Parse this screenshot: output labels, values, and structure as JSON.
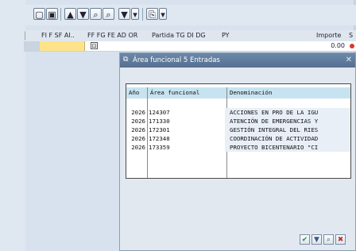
{
  "toolbar": {
    "buttons": [
      {
        "name": "details-icon",
        "glyph": "▢"
      },
      {
        "name": "save-icon",
        "glyph": "▣"
      },
      {
        "name": "sort-ascending-icon",
        "glyph": "▲"
      },
      {
        "name": "sort-descending-icon",
        "glyph": "▼"
      },
      {
        "name": "find-icon",
        "glyph": "⌕"
      },
      {
        "name": "find-next-icon",
        "glyph": "⌕"
      },
      {
        "name": "filter-icon",
        "glyph": "▼"
      },
      {
        "name": "filter-dropdown-icon",
        "glyph": "▾"
      },
      {
        "name": "export-icon",
        "glyph": "⎘"
      },
      {
        "name": "export-dropdown-icon",
        "glyph": "▾"
      }
    ]
  },
  "grid": {
    "headers": [
      "FI F SF AI..",
      "FF FG FE AD OR",
      "Partida TG DI DG",
      "PY",
      "Importe",
      "S"
    ],
    "row": {
      "importe": "0.00"
    }
  },
  "dialog": {
    "title": "Área funcional 5 Entradas",
    "columns": [
      "Año",
      "Área funcional",
      "Denominación"
    ],
    "rows": [
      {
        "year": "2026",
        "area": "124307",
        "denominacion": "ACCIONES EN PRO DE LA IGU"
      },
      {
        "year": "2026",
        "area": "171330",
        "denominacion": "ATENCIÓN DE EMERGENCIAS Y"
      },
      {
        "year": "2026",
        "area": "172301",
        "denominacion": "GESTIÓN INTEGRAL DEL RIES"
      },
      {
        "year": "2026",
        "area": "172348",
        "denominacion": "COORDINACIÓN DE ACTIVIDAD"
      },
      {
        "year": "2026",
        "area": "173359",
        "denominacion": "PROYECTO BICENTENARIO \"CI"
      }
    ],
    "buttons": [
      {
        "name": "confirm-icon",
        "glyph": "✔",
        "color": "#2f8f2f"
      },
      {
        "name": "filter-icon",
        "glyph": "▼",
        "color": "#3a5a80"
      },
      {
        "name": "find-icon",
        "glyph": "⌕",
        "color": "#3a5a80"
      },
      {
        "name": "cancel-icon",
        "glyph": "✖",
        "color": "#c0302a"
      }
    ]
  }
}
